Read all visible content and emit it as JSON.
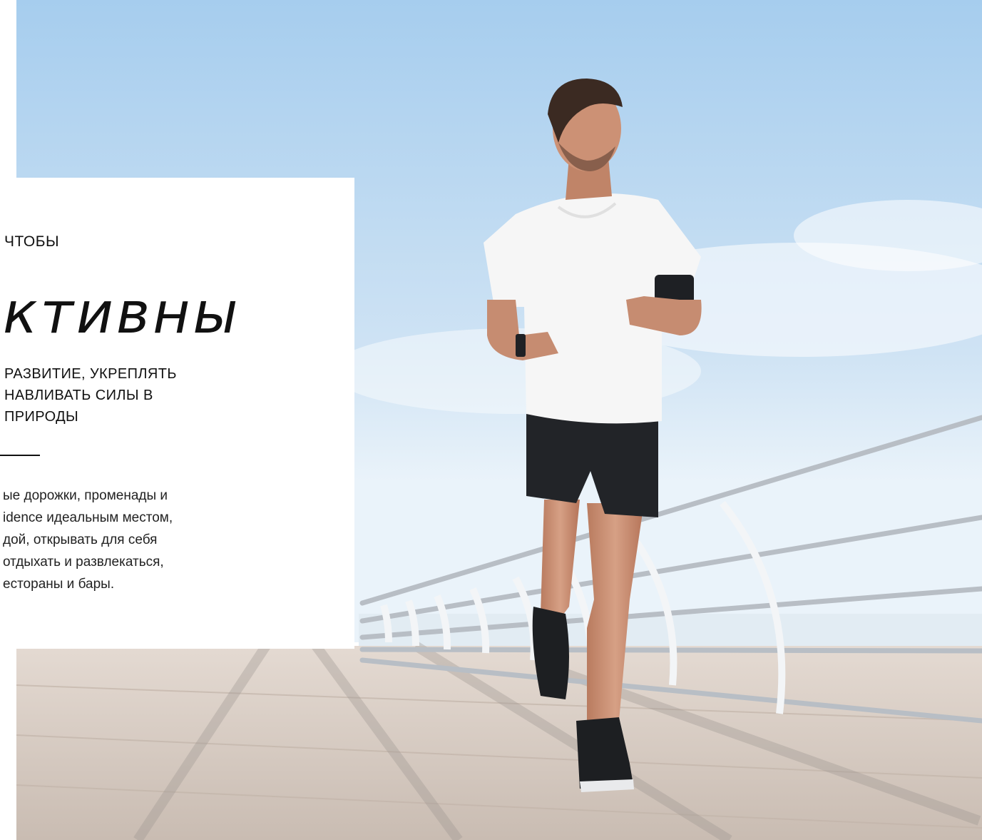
{
  "panel": {
    "eyebrow": "ЧТОБЫ",
    "headline": "ктивны",
    "subhead_lines": [
      "РАЗВИТИЕ, УКРЕПЛЯТЬ",
      "НАВЛИВАТЬ СИЛЫ В",
      "ПРИРОДЫ"
    ],
    "body_lines": [
      "ые дорожки, променады и",
      "idence идеальным местом,",
      "дой, открывать для себя",
      "отдыхать и развлекаться,",
      "есторaны и бары."
    ]
  },
  "photo": {
    "subject": "man-jogging-on-boardwalk",
    "colors": {
      "sky_top": "#a9cfee",
      "sky_bottom": "#e8f2fa",
      "sea": "#dfeaf2",
      "boardwalk": "#d8ccc2",
      "shirt": "#f7f7f7",
      "shorts": "#222428",
      "skin": "#c99075",
      "railing": "#b9bec4"
    }
  }
}
